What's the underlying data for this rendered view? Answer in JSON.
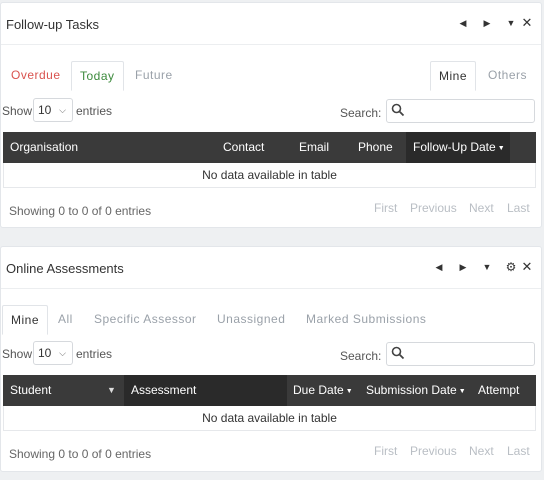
{
  "followup": {
    "title": "Follow-up Tasks",
    "controls": {
      "prev": "◀",
      "next": "▶",
      "collapse": "▼",
      "close": "✕"
    },
    "tabs_left": [
      "Overdue",
      "Today",
      "Future"
    ],
    "tabs_right": [
      "Mine",
      "Others"
    ],
    "show_label": "Show",
    "length_value": "10",
    "entries_label": "entries",
    "search_label": "Search:",
    "search_value": "",
    "columns": [
      "Organisation",
      "Contact",
      "Email",
      "Phone",
      "Follow-Up Date"
    ],
    "empty_message": "No data available in table",
    "info": "Showing 0 to 0 of 0 entries",
    "pager": [
      "First",
      "Previous",
      "Next",
      "Last"
    ]
  },
  "assessments": {
    "title": "Online Assessments",
    "controls": {
      "prev": "◀",
      "next": "▶",
      "collapse": "▼",
      "settings": "⚙",
      "close": "✕"
    },
    "tabs": [
      "Mine",
      "All",
      "Specific Assessor",
      "Unassigned",
      "Marked Submissions"
    ],
    "show_label": "Show",
    "length_value": "10",
    "entries_label": "entries",
    "search_label": "Search:",
    "search_value": "",
    "columns": [
      "Student",
      "Assessment",
      "Due Date",
      "Submission Date",
      "Attempt"
    ],
    "empty_message": "No data available in table",
    "info": "Showing 0 to 0 of 0 entries",
    "pager": [
      "First",
      "Previous",
      "Next",
      "Last"
    ]
  },
  "icons": {
    "search": "search-icon",
    "caret": "chevron-down-icon",
    "sort": "sort-desc-icon"
  },
  "colors": {
    "header_bg": "#3a3a3a",
    "overdue": "#d9534f",
    "today": "#3c8a3c",
    "muted": "#9aa1a9"
  }
}
